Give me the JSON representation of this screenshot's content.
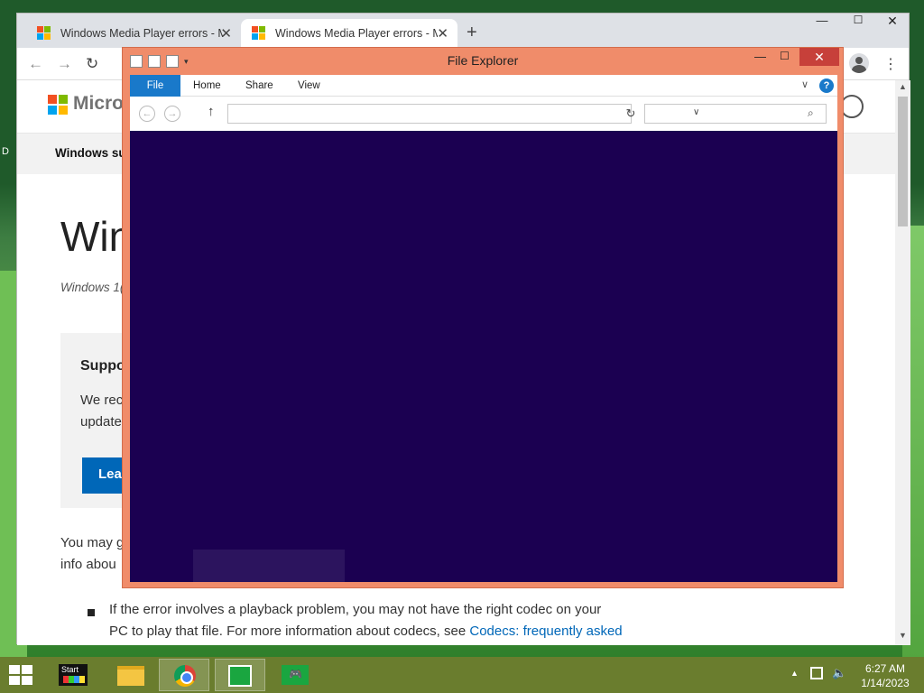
{
  "desktop": {
    "icon_label": "D"
  },
  "browser": {
    "tabs": [
      {
        "title": "Windows Media Player errors - M"
      },
      {
        "title": "Windows Media Player errors - M"
      }
    ],
    "new_tab": "+",
    "window_controls": {
      "minimize": "—",
      "maximize": "☐",
      "close": "✕"
    },
    "toolbar": {
      "back": "←",
      "forward": "→",
      "reload": "↻",
      "menu": "⋮"
    },
    "page": {
      "brand": "Micros",
      "subnav": "Windows su",
      "heading": "Win",
      "applies_to": "Windows 1(",
      "support_box": {
        "title": "Suppo",
        "line1": "We rec",
        "line2": "update",
        "button": "Lear"
      },
      "para_line1": "You may g",
      "para_line2": "info abou",
      "bullet_line1": "If the error involves a playback problem, you may not have the right codec on your",
      "bullet_line2_text": "PC to play that file. For more information about codecs, see ",
      "bullet_line2_link": "Codecs: frequently asked"
    }
  },
  "explorer": {
    "title": "File Explorer",
    "ribbon_tabs": [
      "File",
      "Home",
      "Share",
      "View"
    ],
    "window_controls": {
      "minimize": "—",
      "maximize": "☐",
      "close": "✕"
    },
    "nav": {
      "back": "←",
      "forward": "→",
      "up": "↑",
      "refresh": "↻",
      "dropdown": "∨",
      "search": "⌕"
    },
    "help": "?",
    "address_value": "",
    "search_value": "",
    "content_color": "#1b0051",
    "frame_color": "#f08c6a"
  },
  "taskbar": {
    "start_tile_label": "Start",
    "clock_time": "6:27 AM",
    "clock_date": "1/14/2023",
    "tray_up": "▲",
    "volume": "🔈"
  }
}
